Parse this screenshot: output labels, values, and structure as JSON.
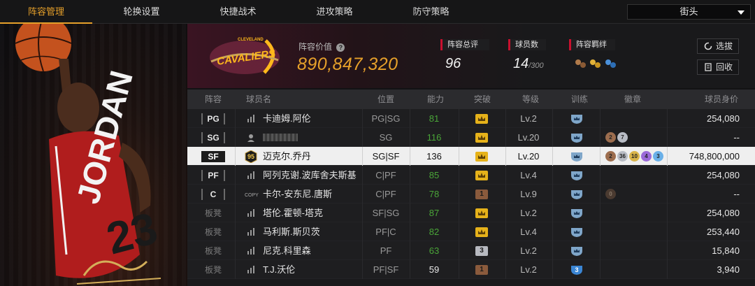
{
  "tabs": [
    {
      "label": "阵容管理",
      "active": true
    },
    {
      "label": "轮换设置",
      "active": false
    },
    {
      "label": "快捷战术",
      "active": false
    },
    {
      "label": "进攻策略",
      "active": false
    },
    {
      "label": "防守策略",
      "active": false
    }
  ],
  "mode_select": {
    "value": "街头"
  },
  "team": {
    "logo_text": "CAVALIERS",
    "logo_sub": "CLEVELAND",
    "value_label": "阵容价值",
    "value": "890,847,320",
    "rating_label": "阵容总评",
    "rating": "96",
    "count_label": "球员数",
    "count": "14",
    "count_max": "/300",
    "bond_label": "阵容羁绊"
  },
  "buttons": {
    "scout": "选拔",
    "recycle": "回收"
  },
  "columns": [
    "阵容",
    "球员名",
    "位置",
    "能力",
    "突破",
    "等级",
    "训练",
    "徽章",
    "球员身价"
  ],
  "rows": [
    {
      "slot": "PG",
      "bench": false,
      "icon": "bars",
      "name": "卡迪姆.阿伦",
      "position": "PG|SG",
      "ability": "81",
      "ability_color": "green",
      "breakthrough": "crown-gold",
      "level": "Lv.2",
      "training": "shield",
      "badges": [],
      "value": "254,080",
      "selected": false
    },
    {
      "slot": "SG",
      "bench": false,
      "icon": "person",
      "name": "",
      "position": "SG",
      "ability": "116",
      "ability_color": "green",
      "breakthrough": "crown-gold",
      "level": "Lv.20",
      "training": "shield",
      "badges": [
        "2",
        "7"
      ],
      "value": "--",
      "selected": false
    },
    {
      "slot": "SF",
      "bench": false,
      "icon": "ovr",
      "ovr": "95",
      "name": "迈克尔.乔丹",
      "position": "SG|SF",
      "ability": "136",
      "ability_color": "dark",
      "breakthrough": "crown-gold",
      "level": "Lv.20",
      "training": "shield",
      "badges": [
        "2",
        "36",
        "10",
        "4",
        "3"
      ],
      "value": "748,800,000",
      "selected": true
    },
    {
      "slot": "PF",
      "bench": false,
      "icon": "bars",
      "name": "阿列克谢.波库舍夫斯基",
      "position": "C|PF",
      "ability": "85",
      "ability_color": "green",
      "breakthrough": "crown-gold",
      "level": "Lv.4",
      "training": "shield",
      "badges": [],
      "value": "254,080",
      "selected": false
    },
    {
      "slot": "C",
      "bench": false,
      "icon": "copy",
      "name": "卡尔-安东尼.唐斯",
      "position": "C|PF",
      "ability": "78",
      "ability_color": "green",
      "breakthrough": "num-1",
      "level": "Lv.9",
      "training": "shield",
      "badges": [
        "0"
      ],
      "value": "--",
      "selected": false
    },
    {
      "slot": "板凳",
      "bench": true,
      "icon": "bars",
      "name": "塔伦.霍顿-塔克",
      "position": "SF|SG",
      "ability": "87",
      "ability_color": "green",
      "breakthrough": "crown-gold",
      "level": "Lv.2",
      "training": "shield",
      "badges": [],
      "value": "254,080",
      "selected": false
    },
    {
      "slot": "板凳",
      "bench": true,
      "icon": "bars",
      "name": "马利斯.斯贝茨",
      "position": "PF|C",
      "ability": "82",
      "ability_color": "green",
      "breakthrough": "crown-gold",
      "level": "Lv.4",
      "training": "shield",
      "badges": [],
      "value": "253,440",
      "selected": false
    },
    {
      "slot": "板凳",
      "bench": true,
      "icon": "bars",
      "name": "尼克.科里森",
      "position": "PF",
      "ability": "63",
      "ability_color": "green",
      "breakthrough": "num-3",
      "level": "Lv.2",
      "training": "shield",
      "badges": [],
      "value": "15,840",
      "selected": false
    },
    {
      "slot": "板凳",
      "bench": true,
      "icon": "bars",
      "name": "T.J.沃伦",
      "position": "PF|SF",
      "ability": "59",
      "ability_color": "white",
      "breakthrough": "num-1",
      "level": "Lv.2",
      "training": "shield-3",
      "badges": [],
      "value": "3,940",
      "selected": false
    }
  ],
  "colors": {
    "accent": "#e6a02a",
    "brand_wine": "#6f263d",
    "brand_gold": "#ffb81c",
    "green": "#4aa538"
  }
}
